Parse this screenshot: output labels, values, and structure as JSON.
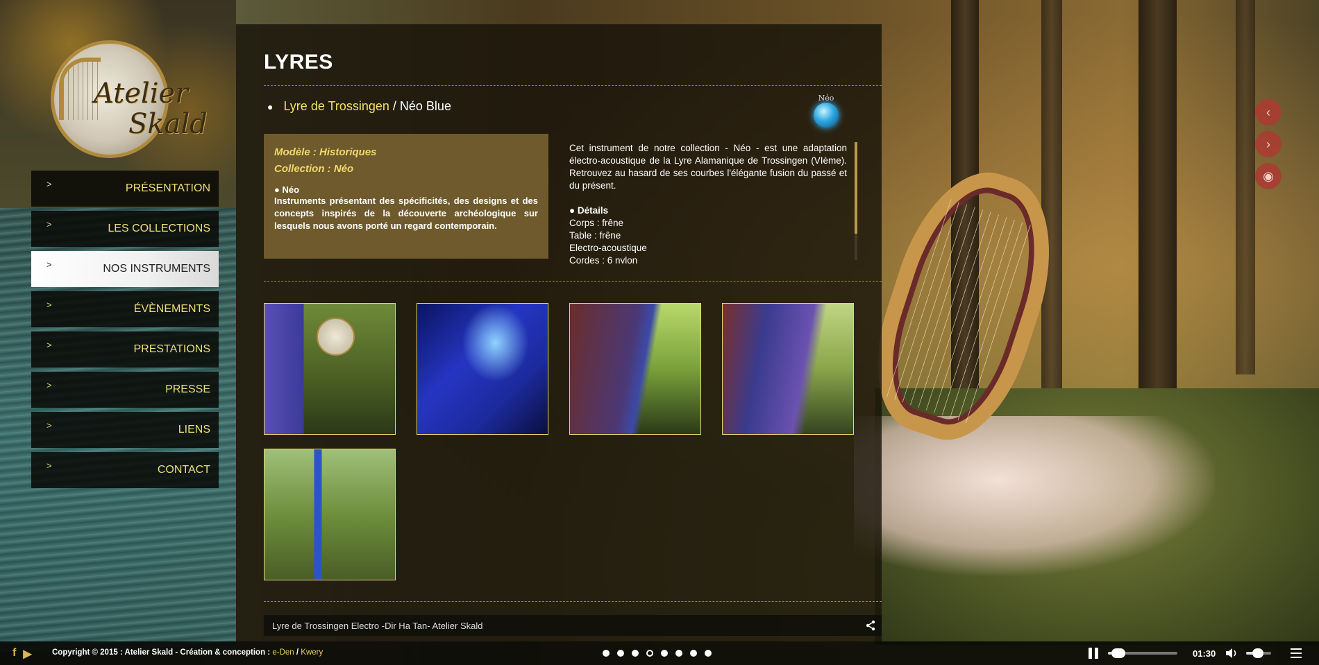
{
  "logo": {
    "line1": "Atelier",
    "line2": "Skald"
  },
  "nav": {
    "arrow": ">",
    "items": [
      {
        "label": "PRÉSENTATION"
      },
      {
        "label": "LES COLLECTIONS"
      },
      {
        "label": "NOS INSTRUMENTS",
        "active": true
      },
      {
        "label": "ÉVÈNEMENTS"
      },
      {
        "label": "PRESTATIONS"
      },
      {
        "label": "PRESSE"
      },
      {
        "label": "LIENS"
      },
      {
        "label": "CONTACT"
      }
    ]
  },
  "content": {
    "title": "LYRES",
    "breadcrumb": {
      "dot": "●",
      "link": "Lyre de Trossingen",
      "separator": "/",
      "current": "Néo Blue"
    },
    "badge": {
      "text": "Néo",
      "icon": "neo-orb-icon"
    },
    "info": {
      "model": "Modèle : Historiques",
      "collection": "Collection : Néo",
      "heading": "● Néo",
      "text": "Instruments présentant des spécificités, des designs et des concepts inspirés de la découverte archéologique sur lesquels nous avons porté un regard contemporain."
    },
    "description": {
      "text": "Cet instrument de notre collection - Néo - est une adaptation électro-acoustique de la Lyre Alamanique de Trossingen (VIème). Retrouvez au hasard de ses courbes l'élégante fusion du passé et du présent.",
      "details_title": "● Détails",
      "details": [
        "Corps : frêne",
        "Table : frêne",
        "Electro-acoustique",
        "Cordes : 6 nylon"
      ]
    },
    "gallery_count": 5,
    "video": {
      "title": "Lyre de Trossingen Electro -Dir Ha Tan- Atelier Skald",
      "share_icon": "share-icon"
    }
  },
  "side_buttons": [
    {
      "icon": "chevron-left-icon",
      "glyph": "‹"
    },
    {
      "icon": "chevron-right-icon",
      "glyph": "›"
    },
    {
      "icon": "eye-slash-icon",
      "glyph": "◉"
    }
  ],
  "footer": {
    "social": [
      {
        "icon": "facebook-icon",
        "glyph": "f"
      },
      {
        "icon": "youtube-icon",
        "glyph": "▶"
      }
    ],
    "copyright": "Copyright © 2015 : Atelier Skald - Création & conception :",
    "link1": "e-Den",
    "slash": "/",
    "link2": "Kwery",
    "slide_dots": 8,
    "active_dot": 3,
    "player": {
      "time": "01:30",
      "progress": 0.05,
      "volume": 0.35
    }
  },
  "colors": {
    "accent": "#efdf7a",
    "active_nav_bg": "#f1f1f1",
    "info_box": "#6e5a2c",
    "side_btn": "#aa3c32"
  }
}
